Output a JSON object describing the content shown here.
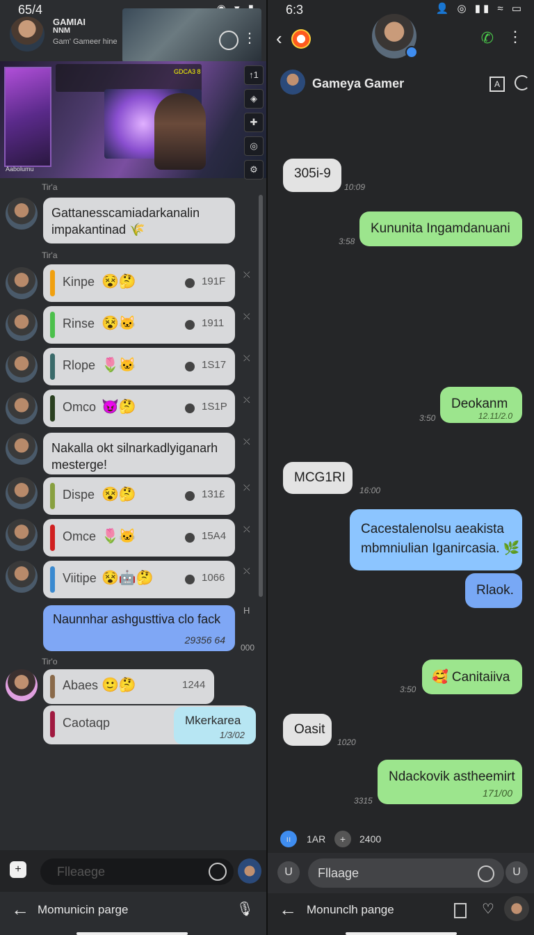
{
  "left": {
    "status": {
      "time": "65/4",
      "icons": "◉ ▾ ▮"
    },
    "header": {
      "line1": "GAMIAI",
      "line2": "NNM",
      "line3": "Gam' Gameer hine"
    },
    "hero": {
      "logo_label": "Aabolumu",
      "hud_text": "GDCA3 8",
      "side_icons": [
        "↑1",
        "◈",
        "✚",
        "◎",
        "⚙"
      ]
    },
    "section_labels": [
      "Tir'a",
      "Tir'a",
      "Tir'o"
    ],
    "pinned_message": "Gattanesscamiadarkanalin impakantinad 🌾",
    "rows": [
      {
        "name": "Kinpe",
        "emoji": "😵🤔",
        "code": "191F",
        "bar": "#f0a010"
      },
      {
        "name": "Rinse",
        "emoji": "😵🐱",
        "code": "1911",
        "bar": "#4cc04c"
      },
      {
        "name": "Rlope",
        "emoji": "🌷🐱",
        "code": "1S17",
        "bar": "#3a6a6a"
      },
      {
        "name": "Omco",
        "emoji": "😈🤔",
        "code": "1S1P",
        "bar": "#2a4020"
      },
      {
        "name": "Dispe",
        "emoji": "😵🤔",
        "code": "131£",
        "bar": "#88a040"
      },
      {
        "name": "Omce",
        "emoji": "🌷🐱",
        "code": "15A4",
        "bar": "#d02020"
      },
      {
        "name": "Viitipe",
        "emoji": "😵🤖🤔",
        "code": "1066",
        "bar": "#3a8ad0"
      }
    ],
    "mid_message": "Nakalla okt silnarkadlyiganarh mesterge!",
    "blue_message": {
      "text": "Naunnhar ashgusttiva clo fack",
      "time": "29356 64",
      "side": "000",
      "mark": "H"
    },
    "bottom_rows": [
      {
        "name": "Abaes",
        "emoji": "🙂🤔",
        "code": "1244",
        "bar": "#8a6a4a"
      },
      {
        "name": "Caotaqp",
        "emoji": "",
        "code": "",
        "bar": "#a01a40"
      }
    ],
    "light_message": {
      "text": "Mkerkarea",
      "time": "1/3/02"
    },
    "input": {
      "placeholder": "Flleaege",
      "plus": "+"
    },
    "footer": {
      "label": "Momunicin parge",
      "back": "←",
      "mic": "🎙"
    }
  },
  "right": {
    "status": {
      "time": "6:3",
      "icons": "👤 ◎ ▮▮ ≈ ▭"
    },
    "header": {
      "back": "‹",
      "call": "✆",
      "more": "⋮"
    },
    "sub": {
      "name": "Gameya Gamer",
      "icon1": "A"
    },
    "messages": [
      {
        "text": "305i-9",
        "time": "10:09"
      },
      {
        "text": "Kununita Ingamdanuani",
        "time": "3:58"
      },
      {
        "text": "Deokanm",
        "time": "3:50",
        "inner": "12.11/2.0"
      },
      {
        "text": "MCG1RI",
        "time": "16:00"
      },
      {
        "text": "Cacestalenolsu aeakista mbmniulian Iganircasia. 🌿",
        "line1": "Cacestalenolsu aeakista",
        "line2": "mbmniulian Iganircasia. 🌿"
      },
      {
        "text": "Rlaok."
      },
      {
        "text": "🥰 Canitaiiva",
        "time": "3:50"
      },
      {
        "text": "Oasit",
        "time": "1020"
      },
      {
        "text": "Ndackovik astheemirt",
        "inner": "171/00",
        "time": "3315"
      }
    ],
    "chips": {
      "c1": "ıı",
      "l1": "1AR",
      "c2": "+",
      "l2": "2400"
    },
    "input": {
      "placeholder": "Fllaage",
      "left_icon": "U",
      "right_icon": "U"
    },
    "footer": {
      "label": "Monunclh pange",
      "back": "←",
      "icon2": "♡"
    }
  }
}
